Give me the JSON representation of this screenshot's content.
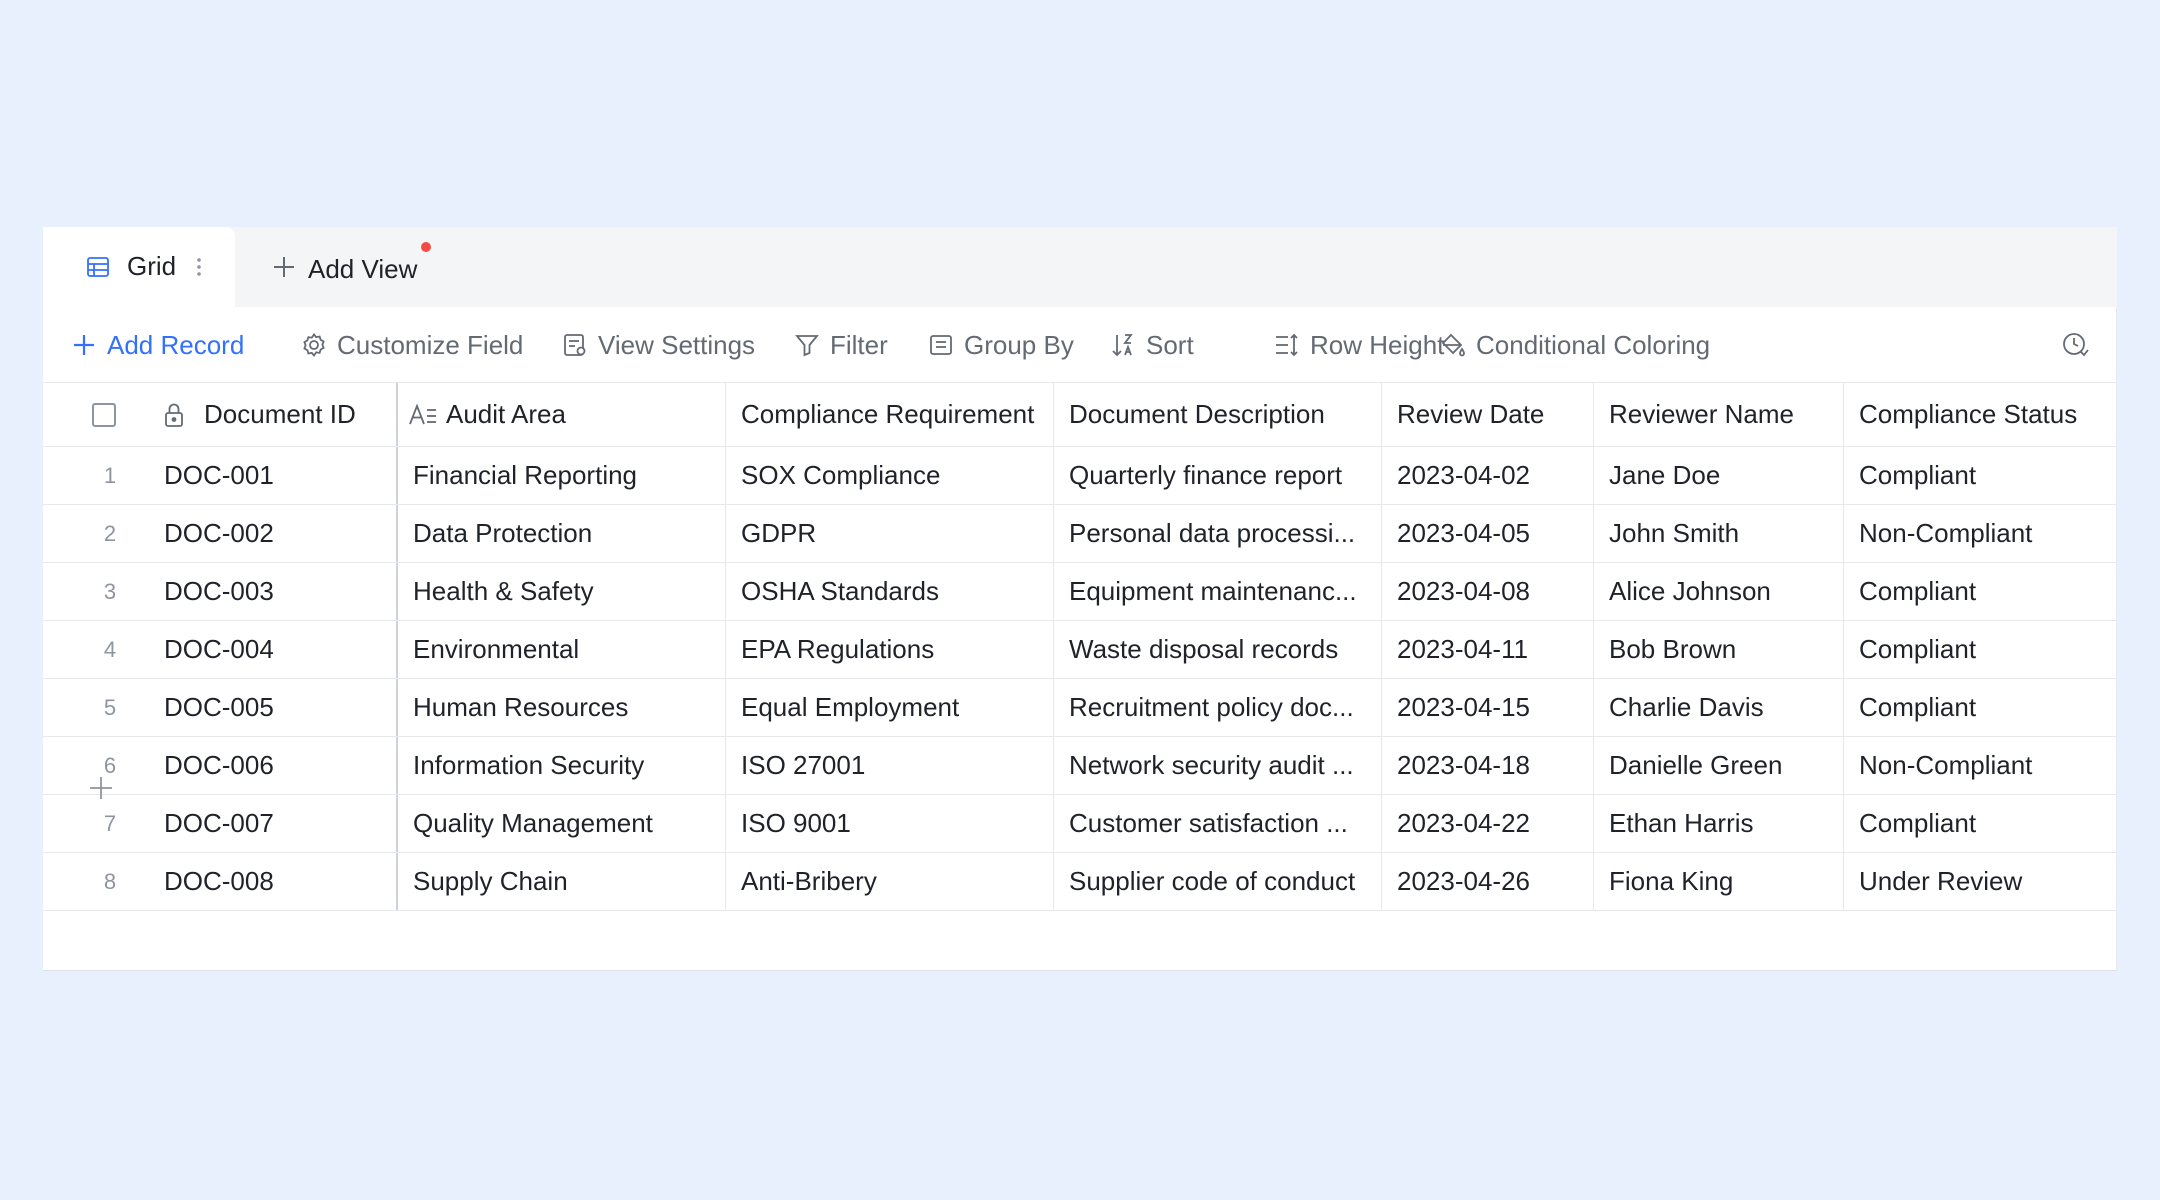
{
  "tabs": {
    "grid_label": "Grid",
    "add_view_label": "Add View"
  },
  "toolbar": {
    "add_record": "Add Record",
    "customize_field": "Customize Field",
    "view_settings": "View Settings",
    "filter": "Filter",
    "group_by": "Group By",
    "sort": "Sort",
    "row_height": "Row Height",
    "conditional_coloring": "Conditional Coloring"
  },
  "table": {
    "columns": [
      "Document ID",
      "Audit Area",
      "Compliance Requirement",
      "Document Description",
      "Review Date",
      "Reviewer Name",
      "Compliance Status"
    ],
    "rows": [
      {
        "num": "1",
        "id": "DOC-001",
        "area": "Financial Reporting",
        "req": "SOX Compliance",
        "desc": "Quarterly finance report",
        "date": "2023-04-02",
        "reviewer": "Jane Doe",
        "status": "Compliant"
      },
      {
        "num": "2",
        "id": "DOC-002",
        "area": "Data Protection",
        "req": "GDPR",
        "desc": "Personal data processi...",
        "date": "2023-04-05",
        "reviewer": "John Smith",
        "status": "Non-Compliant"
      },
      {
        "num": "3",
        "id": "DOC-003",
        "area": "Health & Safety",
        "req": "OSHA Standards",
        "desc": "Equipment maintenanc...",
        "date": "2023-04-08",
        "reviewer": "Alice Johnson",
        "status": "Compliant"
      },
      {
        "num": "4",
        "id": "DOC-004",
        "area": "Environmental",
        "req": "EPA Regulations",
        "desc": "Waste disposal records",
        "date": "2023-04-11",
        "reviewer": "Bob Brown",
        "status": "Compliant"
      },
      {
        "num": "5",
        "id": "DOC-005",
        "area": "Human Resources",
        "req": "Equal Employment",
        "desc": "Recruitment policy doc...",
        "date": "2023-04-15",
        "reviewer": "Charlie Davis",
        "status": "Compliant"
      },
      {
        "num": "6",
        "id": "DOC-006",
        "area": "Information Security",
        "req": "ISO 27001",
        "desc": "Network security audit ...",
        "date": "2023-04-18",
        "reviewer": "Danielle Green",
        "status": "Non-Compliant"
      },
      {
        "num": "7",
        "id": "DOC-007",
        "area": "Quality Management",
        "req": "ISO 9001",
        "desc": "Customer satisfaction ...",
        "date": "2023-04-22",
        "reviewer": "Ethan Harris",
        "status": "Compliant"
      },
      {
        "num": "8",
        "id": "DOC-008",
        "area": "Supply Chain",
        "req": "Anti-Bribery",
        "desc": "Supplier code of conduct",
        "date": "2023-04-26",
        "reviewer": "Fiona King",
        "status": "Under Review"
      }
    ]
  },
  "colors": {
    "accent": "#3370ff",
    "background": "#e8effd",
    "badge_dot": "#f54a45"
  },
  "icons": [
    "grid-view-icon",
    "more-vertical-icon",
    "plus-icon",
    "gear-icon",
    "view-settings-icon",
    "filter-icon",
    "group-by-icon",
    "sort-icon",
    "row-height-icon",
    "paint-bucket-icon",
    "history-icon",
    "lock-icon",
    "text-field-icon"
  ]
}
